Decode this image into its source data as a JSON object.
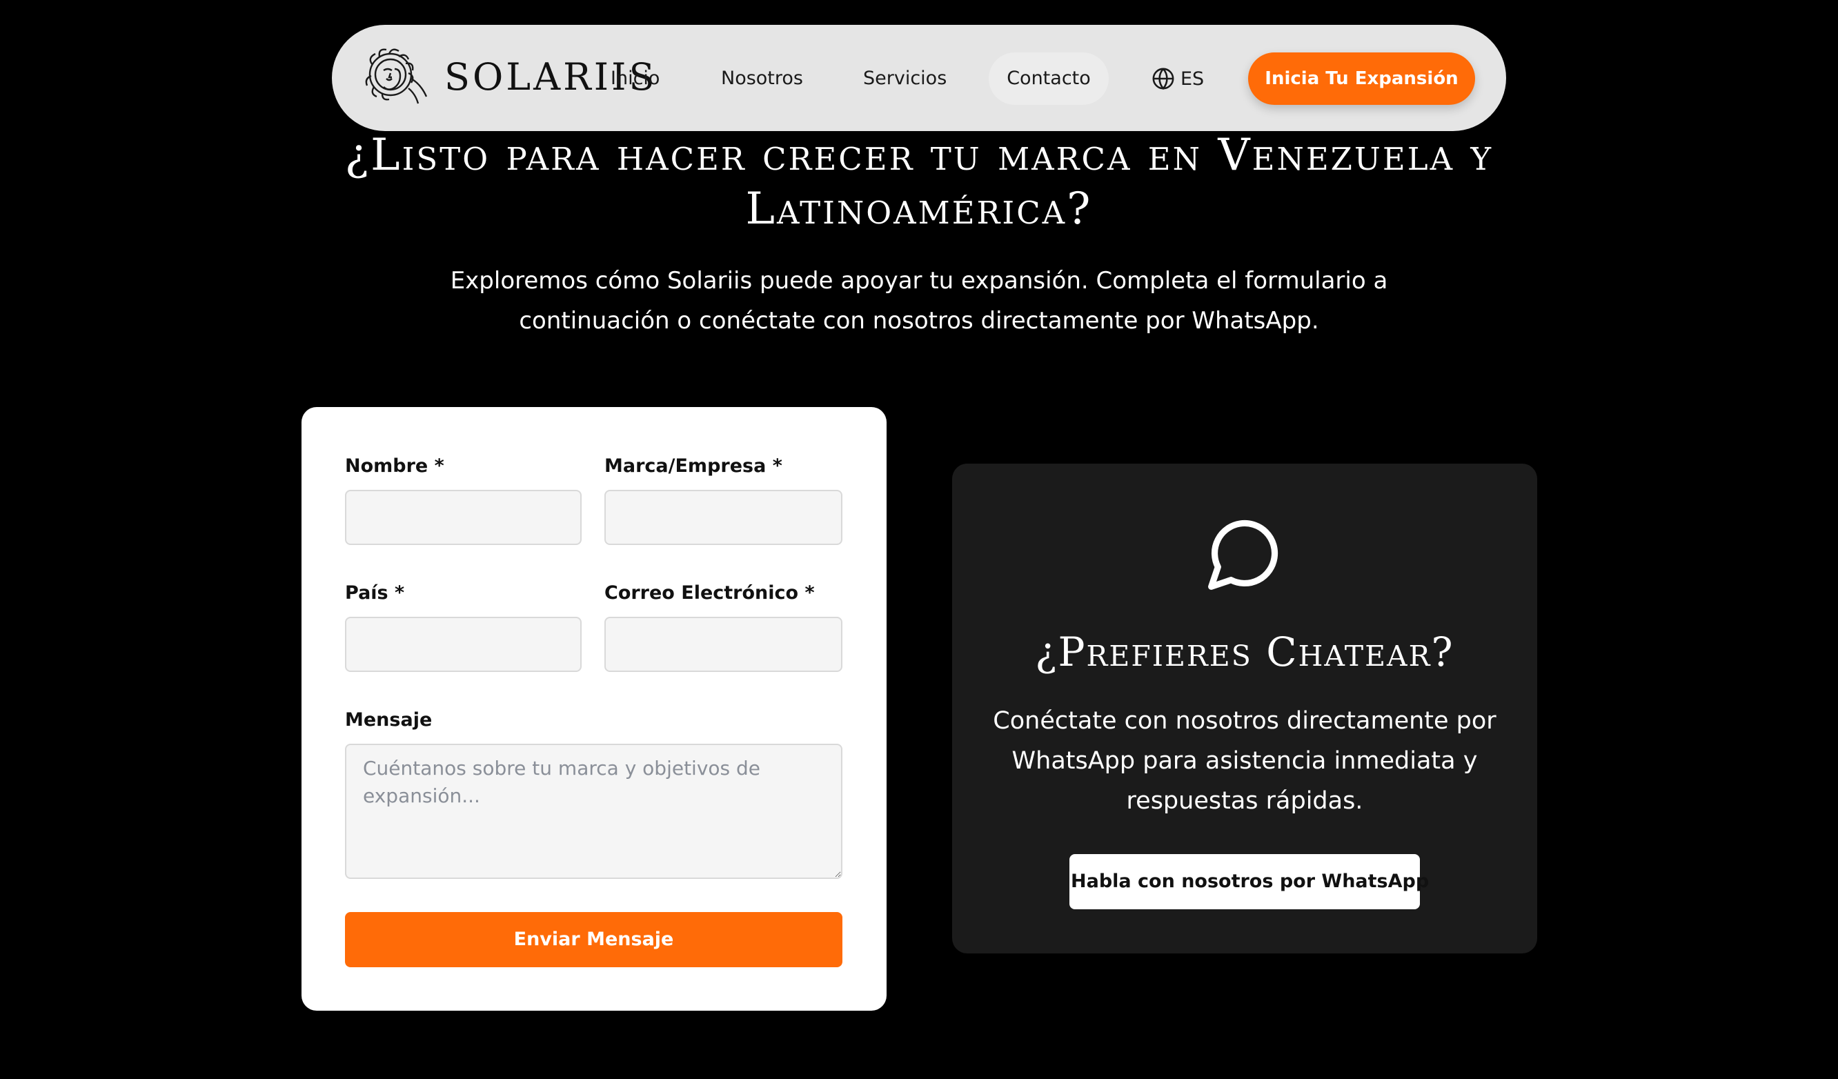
{
  "nav": {
    "brand": "SOLARIIS",
    "links": [
      "Inicio",
      "Nosotros",
      "Servicios",
      "Contacto"
    ],
    "active_link": "Contacto",
    "language": "ES",
    "cta": "Inicia Tu Expansión"
  },
  "hero": {
    "title": "¿Listo para hacer crecer tu marca en Venezuela y Latinoamérica?",
    "subtitle": "Exploremos cómo Solariis puede apoyar tu expansión. Completa el formulario a continuación o conéctate con nosotros directamente por WhatsApp."
  },
  "form": {
    "name_label": "Nombre *",
    "name_value": "",
    "brand_label": "Marca/Empresa *",
    "brand_value": "",
    "country_label": "País *",
    "country_value": "",
    "email_label": "Correo Electrónico *",
    "email_value": "",
    "message_label": "Mensaje",
    "message_placeholder": "Cuéntanos sobre tu marca y objetivos de expansión...",
    "submit": "Enviar Mensaje"
  },
  "chat": {
    "icon": "chat-bubble-icon",
    "title": "¿Prefieres Chatear?",
    "text": "Conéctate con nosotros directamente por WhatsApp para asistencia inmediata y respuestas rápidas.",
    "button": "Habla con nosotros por WhatsApp"
  },
  "colors": {
    "accent": "#ff6b08",
    "background": "#000000",
    "card_dark": "#1b1b1b",
    "nav_bg": "#e5e5e5"
  }
}
